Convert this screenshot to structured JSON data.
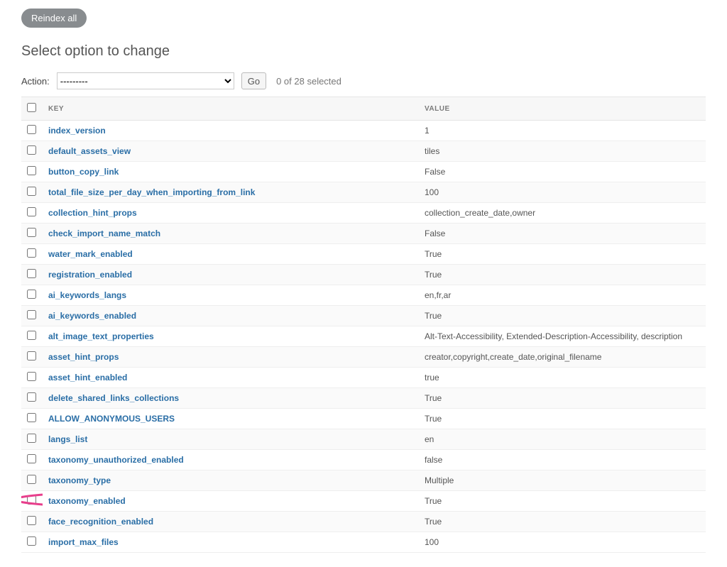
{
  "header": {
    "reindex_label": "Reindex all"
  },
  "page_title": "Select option to change",
  "action_bar": {
    "label": "Action:",
    "select_placeholder": "---------",
    "go_label": "Go",
    "selection_text": "0 of 28 selected"
  },
  "table": {
    "columns": {
      "key": "KEY",
      "value": "VALUE"
    },
    "rows": [
      {
        "key": "index_version",
        "value": "1"
      },
      {
        "key": "default_assets_view",
        "value": "tiles"
      },
      {
        "key": "button_copy_link",
        "value": "False"
      },
      {
        "key": "total_file_size_per_day_when_importing_from_link",
        "value": "100"
      },
      {
        "key": "collection_hint_props",
        "value": "collection_create_date,owner"
      },
      {
        "key": "check_import_name_match",
        "value": "False"
      },
      {
        "key": "water_mark_enabled",
        "value": "True"
      },
      {
        "key": "registration_enabled",
        "value": "True"
      },
      {
        "key": "ai_keywords_langs",
        "value": "en,fr,ar"
      },
      {
        "key": "ai_keywords_enabled",
        "value": "True"
      },
      {
        "key": "alt_image_text_properties",
        "value": "Alt-Text-Accessibility, Extended-Description-Accessibility, description"
      },
      {
        "key": "asset_hint_props",
        "value": "creator,copyright,create_date,original_filename"
      },
      {
        "key": "asset_hint_enabled",
        "value": "true"
      },
      {
        "key": "delete_shared_links_collections",
        "value": "True"
      },
      {
        "key": "ALLOW_ANONYMOUS_USERS",
        "value": "True"
      },
      {
        "key": "langs_list",
        "value": "en"
      },
      {
        "key": "taxonomy_unauthorized_enabled",
        "value": "false"
      },
      {
        "key": "taxonomy_type",
        "value": "Multiple"
      },
      {
        "key": "taxonomy_enabled",
        "value": "True",
        "highlight": true
      },
      {
        "key": "face_recognition_enabled",
        "value": "True"
      },
      {
        "key": "import_max_files",
        "value": "100"
      }
    ]
  },
  "colors": {
    "link": "#2a6ea6",
    "highlight": "#e83e8c"
  }
}
